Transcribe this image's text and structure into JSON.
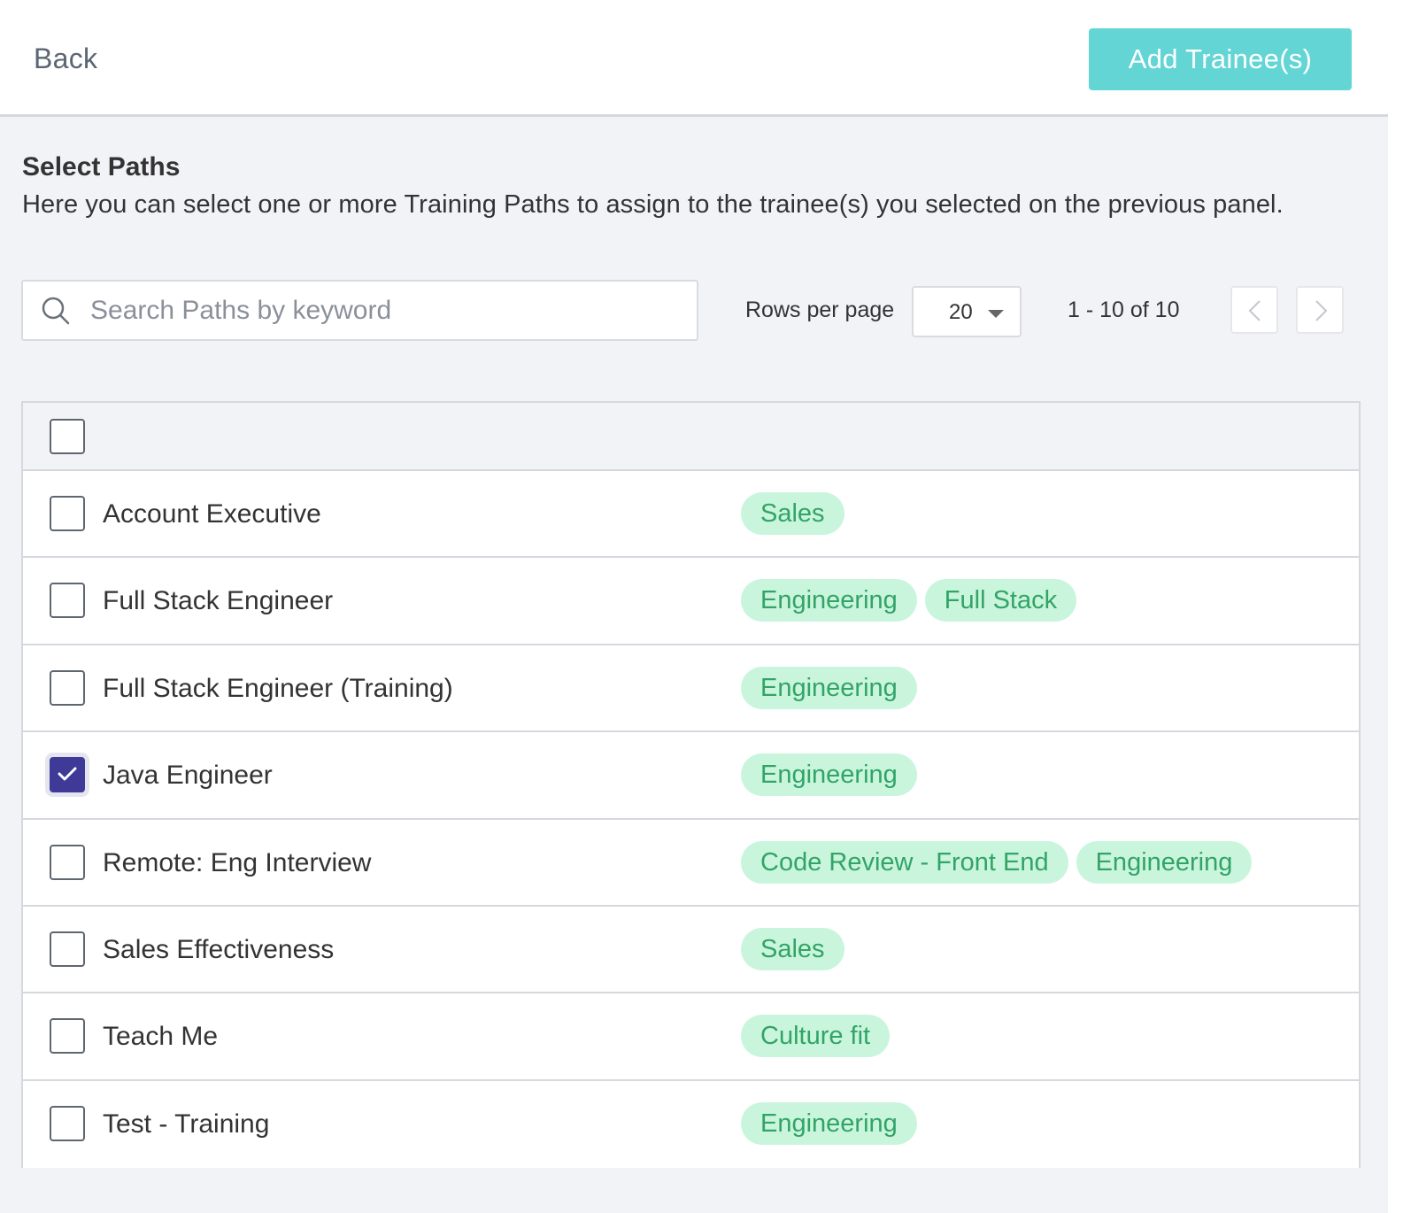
{
  "header": {
    "back_label": "Back",
    "add_button_label": "Add Trainee(s)",
    "add_button_color": "#64d5d5"
  },
  "section": {
    "title": "Select Paths",
    "description": "Here you can select one or more Training Paths to assign to the trainee(s) you selected on the previous panel."
  },
  "search": {
    "placeholder": "Search Paths by keyword",
    "value": "",
    "icon": "search-icon"
  },
  "pagination": {
    "rows_label": "Rows per page",
    "rows_value": "20",
    "range": "1 - 10 of 10",
    "prev_icon": "chevron-left-icon",
    "next_icon": "chevron-right-icon"
  },
  "table": {
    "select_all_checked": false,
    "rows": [
      {
        "name": "Account Executive",
        "checked": false,
        "tags": [
          "Sales"
        ]
      },
      {
        "name": "Full Stack Engineer",
        "checked": false,
        "tags": [
          "Engineering",
          "Full Stack"
        ]
      },
      {
        "name": "Full Stack Engineer (Training)",
        "checked": false,
        "tags": [
          "Engineering"
        ]
      },
      {
        "name": "Java Engineer",
        "checked": true,
        "tags": [
          "Engineering"
        ]
      },
      {
        "name": "Remote: Eng Interview",
        "checked": false,
        "tags": [
          "Code Review - Front End",
          "Engineering"
        ]
      },
      {
        "name": "Sales Effectiveness",
        "checked": false,
        "tags": [
          "Sales"
        ]
      },
      {
        "name": "Teach Me",
        "checked": false,
        "tags": [
          "Culture fit"
        ]
      },
      {
        "name": "Test - Training",
        "checked": false,
        "tags": [
          "Engineering"
        ]
      }
    ]
  },
  "colors": {
    "checkbox_checked": "#3f3a97",
    "tag_background": "#c9f5dd",
    "tag_text": "#32a466"
  }
}
